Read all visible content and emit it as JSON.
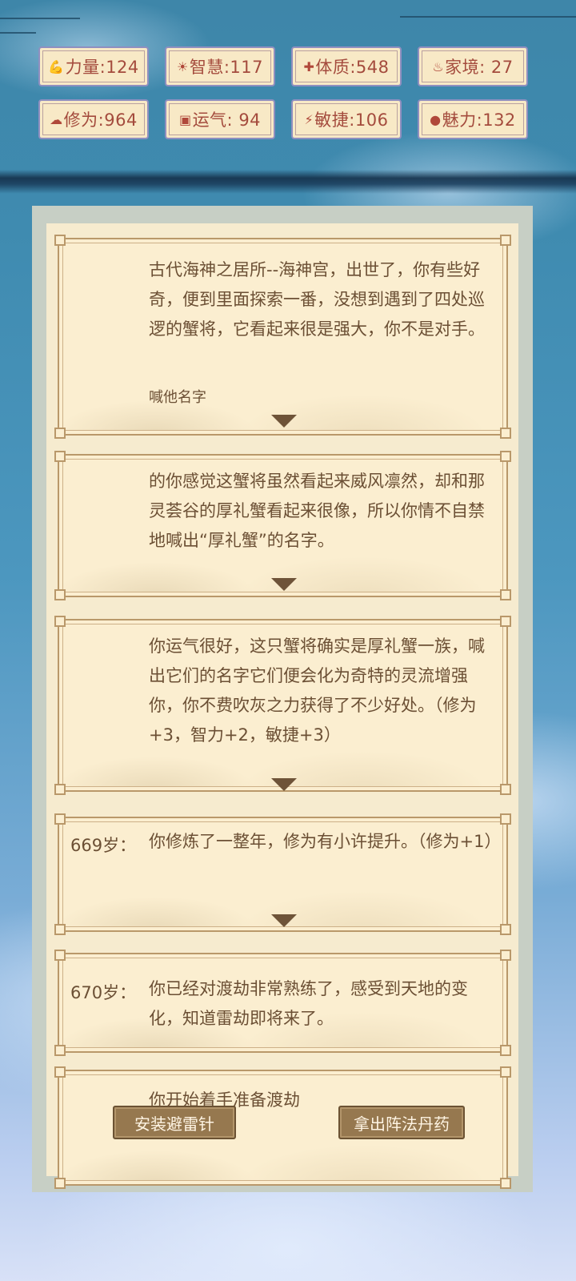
{
  "stats": [
    {
      "icon": "strength-icon",
      "glyph": "💪",
      "label": "力量:124"
    },
    {
      "icon": "wisdom-icon",
      "glyph": "☀",
      "label": "智慧:117"
    },
    {
      "icon": "constitution-icon",
      "glyph": "✚",
      "label": "体质:548"
    },
    {
      "icon": "family-icon",
      "glyph": "♨",
      "label": "家境: 27"
    },
    {
      "icon": "cultivation-icon",
      "glyph": "☁",
      "label": "修为:964"
    },
    {
      "icon": "luck-icon",
      "glyph": "▣",
      "label": "运气: 94"
    },
    {
      "icon": "agility-icon",
      "glyph": "⚡",
      "label": "敏捷:106"
    },
    {
      "icon": "charm-icon",
      "glyph": "●",
      "label": "魅力:132"
    }
  ],
  "events": [
    {
      "age": "",
      "text": "古代海神之居所--海神宫，出世了，你有些好奇，便到里面探索一番，没想到遇到了四处巡逻的蟹将，它看起来很是强大，你不是对手。",
      "option": "喊他名字"
    },
    {
      "age": "",
      "text": "的你感觉这蟹将虽然看起来威风凛然，却和那灵荟谷的厚礼蟹看起来很像，所以你情不自禁地喊出“厚礼蟹”的名字。",
      "option": ""
    },
    {
      "age": "",
      "text": "你运气很好，这只蟹将确实是厚礼蟹一族，喊出它们的名字它们便会化为奇特的灵流增强你，你不费吹灰之力获得了不少好处。（修为+3，智力+2，敏捷+3）",
      "option": ""
    },
    {
      "age": "669岁：",
      "text": "你修炼了一整年，修为有小许提升。（修为+1）",
      "option": ""
    },
    {
      "age": "670岁：",
      "text": "你已经对渡劫非常熟练了，感受到天地的变化，知道雷劫即将来了。",
      "option": ""
    },
    {
      "age": "",
      "text": "你开始着手准备渡劫",
      "option": ""
    }
  ],
  "choices": [
    {
      "label": "安装避雷针"
    },
    {
      "label": "拿出阵法丹药"
    }
  ],
  "colors": {
    "accent": "#a44b3d",
    "text": "#6b4f34",
    "button": "#96784f"
  }
}
